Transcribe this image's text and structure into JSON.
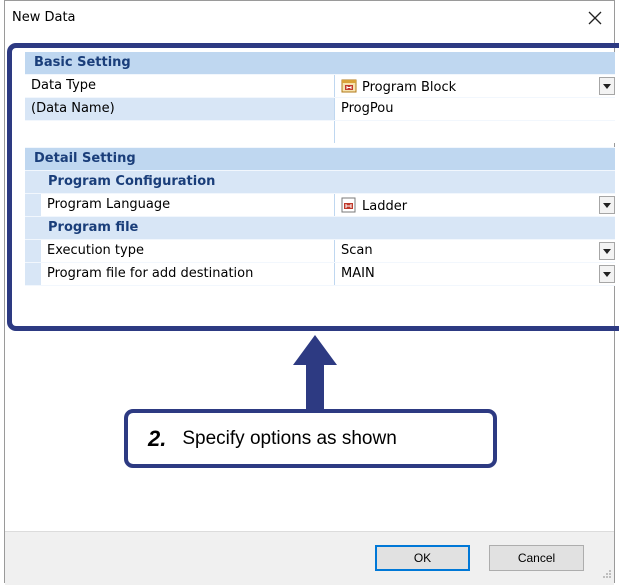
{
  "dialog": {
    "title": "New Data"
  },
  "basic": {
    "header": "Basic Setting",
    "data_type": {
      "label": "Data Type",
      "value": "Program Block",
      "icon": "program-block-icon"
    },
    "data_name": {
      "label": "(Data Name)",
      "value": "ProgPou"
    }
  },
  "detail": {
    "header": "Detail Setting",
    "config": {
      "header": "Program Configuration",
      "language": {
        "label": "Program Language",
        "value": "Ladder",
        "icon": "ladder-icon"
      }
    },
    "file": {
      "header": "Program file",
      "execution": {
        "label": "Execution type",
        "value": "Scan"
      },
      "destination": {
        "label": "Program file for add destination",
        "value": "MAIN"
      }
    }
  },
  "annotation": {
    "step": "2.",
    "text": "Specify options as shown"
  },
  "buttons": {
    "ok": "OK",
    "cancel": "Cancel"
  },
  "colors": {
    "highlight": "#2d3a82",
    "category_bg": "#bfd7f0",
    "category_text": "#1a3e7a",
    "ok_border": "#0078d7"
  }
}
